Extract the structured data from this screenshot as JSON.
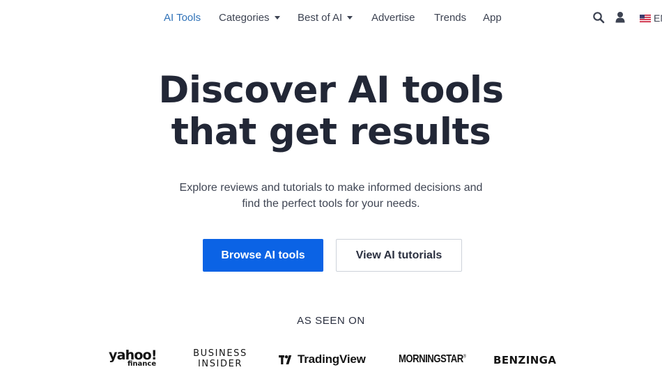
{
  "nav": {
    "items": [
      {
        "label": "AI Tools",
        "active": true,
        "has_dropdown": false
      },
      {
        "label": "Categories",
        "active": false,
        "has_dropdown": true
      },
      {
        "label": "Best of AI",
        "active": false,
        "has_dropdown": true
      },
      {
        "label": "Advertise",
        "active": false,
        "has_dropdown": false
      },
      {
        "label": "Trends",
        "active": false,
        "has_dropdown": false
      },
      {
        "label": "App",
        "active": false,
        "has_dropdown": false
      }
    ],
    "icons": {
      "search": "search-icon",
      "user": "user-icon",
      "flag": "us-flag-icon"
    },
    "language": "EN"
  },
  "hero": {
    "title_line1": "Discover AI tools",
    "title_line2": "that get results",
    "subtitle_line1": "Explore reviews and tutorials to make informed decisions and",
    "subtitle_line2": "find the perfect tools for your needs.",
    "primary_button": "Browse AI tools",
    "secondary_button": "View AI tutorials"
  },
  "as_seen_on": {
    "heading": "AS SEEN ON",
    "logos": {
      "yahoo_main": "yahoo!",
      "yahoo_sub": "finance",
      "bi_line1": "BUSINESS",
      "bi_line2": "INSIDER",
      "tradingview": "TradingView",
      "morningstar": "MORNINGSTAR",
      "benzinga": "BENZINGA"
    }
  },
  "colors": {
    "accent_link": "#2f72b8",
    "primary_button": "#0b63e5",
    "heading_text": "#222736"
  }
}
